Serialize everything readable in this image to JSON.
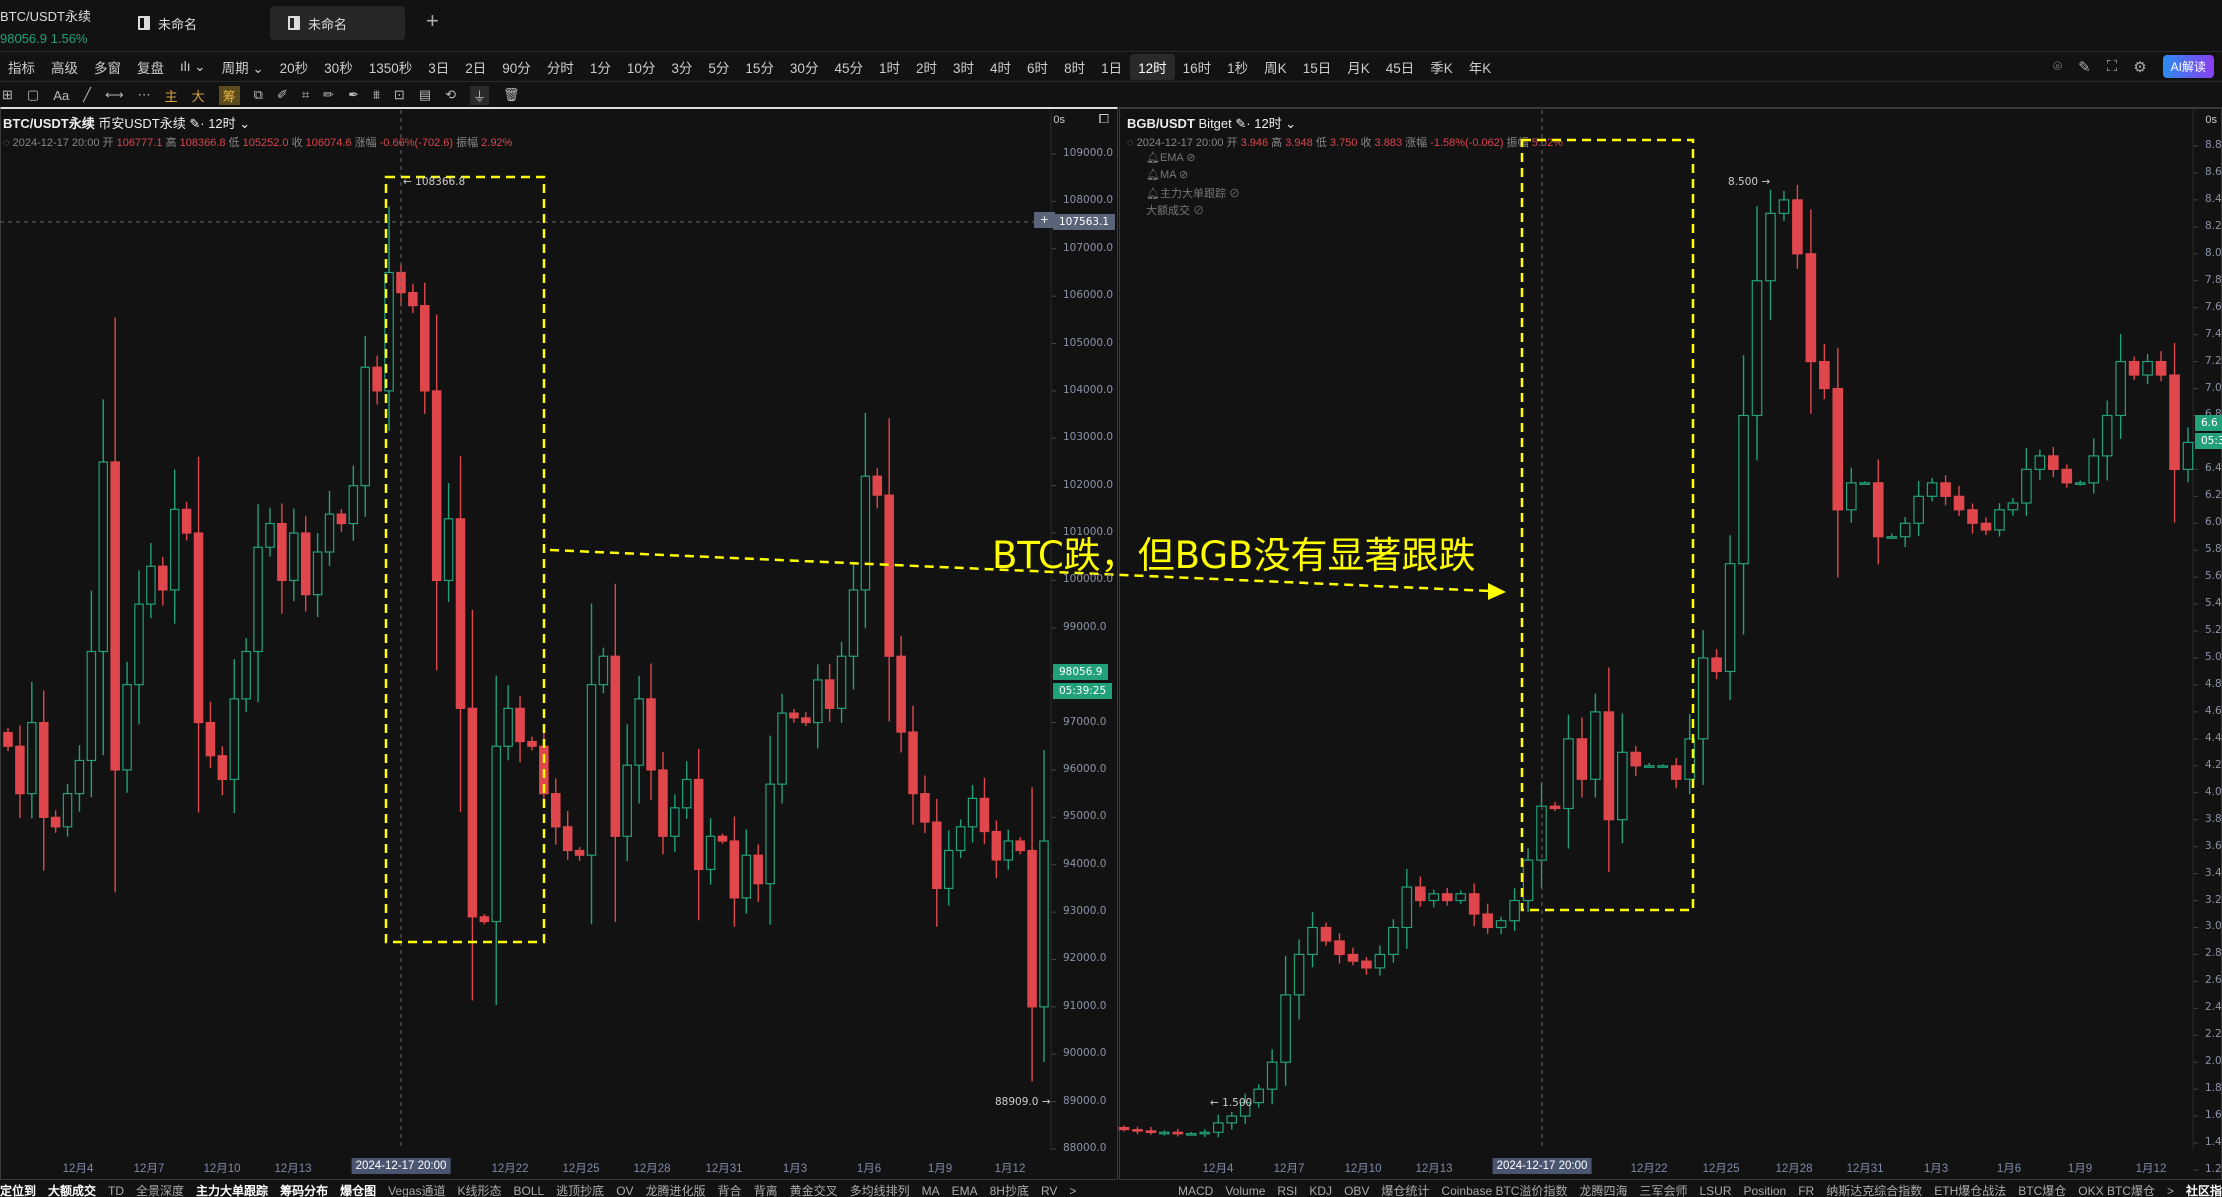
{
  "tabbar": {
    "symbol": "BTC/USDT永续",
    "price": "98056.9",
    "change": "1.56%",
    "tabs": [
      "未命名",
      "未命名"
    ],
    "add": "+"
  },
  "timeframes": {
    "left_items": [
      "指标",
      "高级",
      "多窗",
      "复盘",
      "ılı ⌄",
      "周期 ⌄"
    ],
    "periods": [
      "20秒",
      "30秒",
      "1350秒",
      "3日",
      "2日",
      "90分",
      "分时",
      "1分",
      "10分",
      "3分",
      "5分",
      "15分",
      "30分",
      "45分",
      "1时",
      "2时",
      "3时",
      "4时",
      "6时",
      "8时",
      "1日",
      "12时",
      "16时",
      "1秒",
      "周K",
      "15日",
      "月K",
      "45日",
      "季K",
      "年K"
    ],
    "selected": "12时",
    "ai": "AI解读"
  },
  "drawing_tools": {
    "main": "主",
    "big": "大",
    "chips": "筹"
  },
  "left_chart": {
    "title": "BTC/USDT永续",
    "exchange": "币安USDT永续",
    "interval": "· 12时 ⌄",
    "seconds": "0s",
    "ohlc": {
      "date": "2024-12-17 20:00",
      "open_label": "开",
      "open": "106777.1",
      "high_label": "高",
      "high": "108366.8",
      "low_label": "低",
      "low": "105252.0",
      "close_label": "收",
      "close": "106074.6",
      "chg_label": "涨幅",
      "chg": "-0.66%(-702.6)",
      "amp_label": "振幅",
      "amp": "2.92%"
    },
    "yticks": [
      "109000.0",
      "108000.0",
      "107000.0",
      "106000.0",
      "105000.0",
      "104000.0",
      "103000.0",
      "102000.0",
      "101000.0",
      "100000.0",
      "99000.0",
      "98000.0",
      "97000.0",
      "96000.0",
      "95000.0",
      "94000.0",
      "93000.0",
      "92000.0",
      "91000.0",
      "90000.0",
      "89000.0",
      "88000.0"
    ],
    "crosshair_price": "107563.1",
    "last_price": "98056.9",
    "countdown": "05:39:25",
    "max_label": "← 108366.8",
    "min_label": "88909.0 →",
    "xticks": [
      "12月4",
      "12月7",
      "12月10",
      "12月13",
      "12月22",
      "12月25",
      "12月28",
      "12月31",
      "1月3",
      "1月6",
      "1月9",
      "1月12"
    ],
    "crosshair_time": "2024-12-17 20:00"
  },
  "right_chart": {
    "title": "BGB/USDT",
    "exchange": "Bitget",
    "interval": "· 12时 ⌄",
    "seconds": "0s",
    "ohlc": {
      "date": "2024-12-17 20:00",
      "open_label": "开",
      "open": "3.946",
      "high_label": "高",
      "high": "3.948",
      "low_label": "低",
      "low": "3.750",
      "close_label": "收",
      "close": "3.883",
      "chg_label": "涨幅",
      "chg": "-1.58%(-0.062)",
      "amp_label": "振幅",
      "amp": "5.02%"
    },
    "indicators": [
      "EMA",
      "MA",
      "主力大单跟踪",
      "大额成交"
    ],
    "yticks": [
      "8.8",
      "8.6",
      "8.4",
      "8.2",
      "8.0",
      "7.8",
      "7.6",
      "7.4",
      "7.2",
      "7.0",
      "6.8",
      "6.6",
      "6.4",
      "6.2",
      "6.0",
      "5.8",
      "5.6",
      "5.4",
      "5.2",
      "5.0",
      "4.8",
      "4.6",
      "4.4",
      "4.2",
      "4.0",
      "3.8",
      "3.6",
      "3.4",
      "3.2",
      "3.0",
      "2.8",
      "2.6",
      "2.4",
      "2.2",
      "2.0",
      "1.8",
      "1.6",
      "1.4",
      "1.2"
    ],
    "last_price": "6.6",
    "countdown": "05:3",
    "max_label": "8.500 →",
    "min_label": "← 1.500",
    "xticks": [
      "12月4",
      "12月7",
      "12月10",
      "12月13",
      "12月22",
      "12月25",
      "12月28",
      "12月31",
      "1月3",
      "1月6",
      "1月9",
      "1月12"
    ],
    "crosshair_time": "2024-12-17 20:00"
  },
  "annotation": "BTC跌，但BGB没有显著跟跌",
  "bottom": {
    "left": [
      "定位到",
      "大额成交",
      "TD",
      "全景深度",
      "主力大单跟踪",
      "筹码分布",
      "爆仓图",
      "Vegas通道",
      "K线形态",
      "BOLL",
      "逃顶抄底",
      "OV",
      "龙腾进化版",
      "背合",
      "背离",
      "黄金交叉",
      "多均线排列",
      "MA",
      "EMA",
      "8H抄底",
      "RV",
      ">"
    ],
    "right": [
      "MACD",
      "Volume",
      "RSI",
      "KDJ",
      "OBV",
      "爆仓统计",
      "Coinbase BTC溢价指数",
      "龙腾四海",
      "三军会师",
      "LSUR",
      "Position",
      "FR",
      "纳斯达克综合指数",
      "ETH爆仓战法",
      "BTC爆仓",
      "OKX BTC爆仓",
      ">",
      "社区指标"
    ]
  },
  "colors": {
    "up": "#22a07a",
    "down": "#e0474c",
    "annotation": "#ffff00",
    "background": "#121212"
  },
  "chart_data": [
    {
      "type": "candlestick",
      "series": "BTC/USDT永续 12时",
      "ylim": [
        88000,
        109000
      ],
      "closes": [
        96500,
        95500,
        97000,
        95000,
        94800,
        95500,
        96200,
        98500,
        102500,
        96000,
        97800,
        99500,
        100300,
        99800,
        101500,
        101000,
        97000,
        96300,
        95800,
        97500,
        98500,
        100700,
        101200,
        100000,
        101000,
        99700,
        100600,
        101400,
        101200,
        102000,
        104500,
        104000,
        106500,
        106074.6,
        105800,
        104000,
        100000,
        101300,
        97300,
        92900,
        92800,
        96500,
        97300,
        96600,
        96500,
        95500,
        94800,
        94300,
        94200,
        97800,
        98400,
        94600,
        96100,
        97500,
        96000,
        94600,
        95200,
        95800,
        93900,
        94600,
        94500,
        93300,
        94200,
        93600,
        95700,
        97200,
        97100,
        97000,
        97900,
        97300,
        98400,
        99800,
        102200,
        101800,
        98400,
        96800,
        95500,
        94900,
        93500,
        94300,
        94800,
        95400,
        94700,
        94100,
        94500,
        94300,
        91000,
        94500
      ]
    },
    {
      "type": "candlestick",
      "series": "BGB/USDT 12时",
      "ylim": [
        1.2,
        8.8
      ],
      "closes": [
        1.5,
        1.49,
        1.48,
        1.48,
        1.47,
        1.47,
        1.48,
        1.55,
        1.6,
        1.7,
        1.8,
        2.0,
        2.5,
        2.8,
        3.0,
        2.9,
        2.8,
        2.75,
        2.7,
        2.8,
        3.0,
        3.3,
        3.2,
        3.25,
        3.2,
        3.25,
        3.1,
        3.0,
        3.05,
        3.2,
        3.5,
        3.9,
        3.883,
        4.4,
        4.1,
        4.6,
        3.8,
        4.3,
        4.2,
        4.2,
        4.2,
        4.1,
        4.4,
        5.0,
        4.9,
        5.7,
        6.8,
        7.8,
        8.3,
        8.4,
        8.0,
        7.2,
        7.0,
        6.1,
        6.3,
        6.3,
        5.9,
        5.9,
        6.0,
        6.2,
        6.3,
        6.2,
        6.1,
        6.0,
        5.95,
        6.1,
        6.15,
        6.4,
        6.5,
        6.4,
        6.3,
        6.3,
        6.5,
        6.8,
        7.2,
        7.1,
        7.2,
        7.1,
        6.4,
        6.6
      ]
    }
  ]
}
